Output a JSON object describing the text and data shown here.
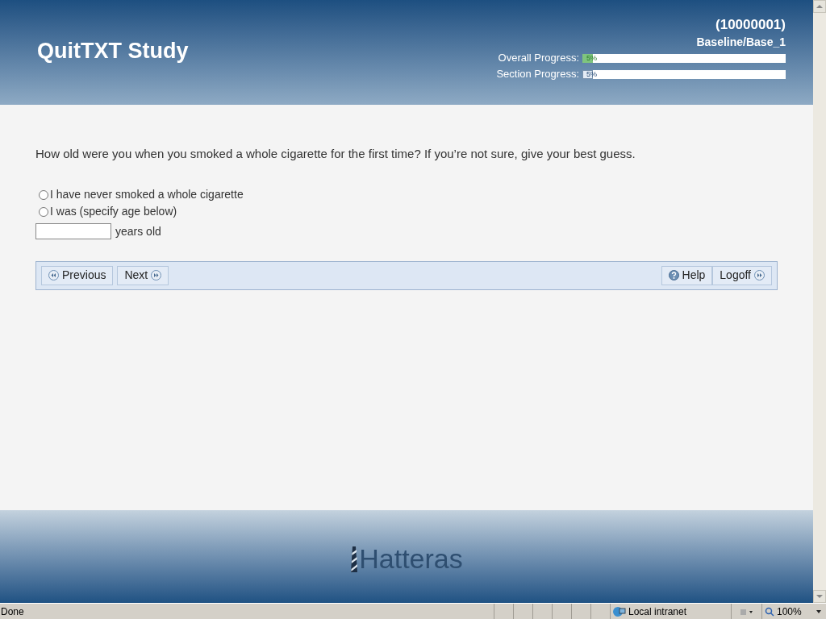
{
  "header": {
    "title": "QuitTXT Study",
    "participant_id": "(10000001)",
    "section": "Baseline/Base_1",
    "progress": [
      {
        "label": "Overall Progress:",
        "level": 0.05,
        "reading": "5%",
        "kind": "overall"
      },
      {
        "label": "Section Progress:",
        "level": 0.05,
        "reading": "5%",
        "kind": "section"
      }
    ]
  },
  "question": {
    "text": "How old were you when you smoked a whole cigarette for the first time? If you’re not sure, give your best guess.",
    "options": [
      {
        "label": "I have never smoked a whole cigarette",
        "selected": false
      },
      {
        "label": "I was (specify age below)",
        "selected": false
      }
    ],
    "age_suffix": "years old"
  },
  "nav": {
    "left": [
      {
        "label": "Previous",
        "kind": "prev"
      },
      {
        "label": "Next",
        "kind": "next"
      }
    ],
    "right": [
      {
        "label": "Help",
        "kind": "help"
      },
      {
        "label": "Logoff",
        "kind": "logoff"
      }
    ]
  },
  "footer": {
    "logo": "Hatteras"
  },
  "status_bar": {
    "text": "Done",
    "zone": "Local intranet",
    "zoom": "100%"
  }
}
